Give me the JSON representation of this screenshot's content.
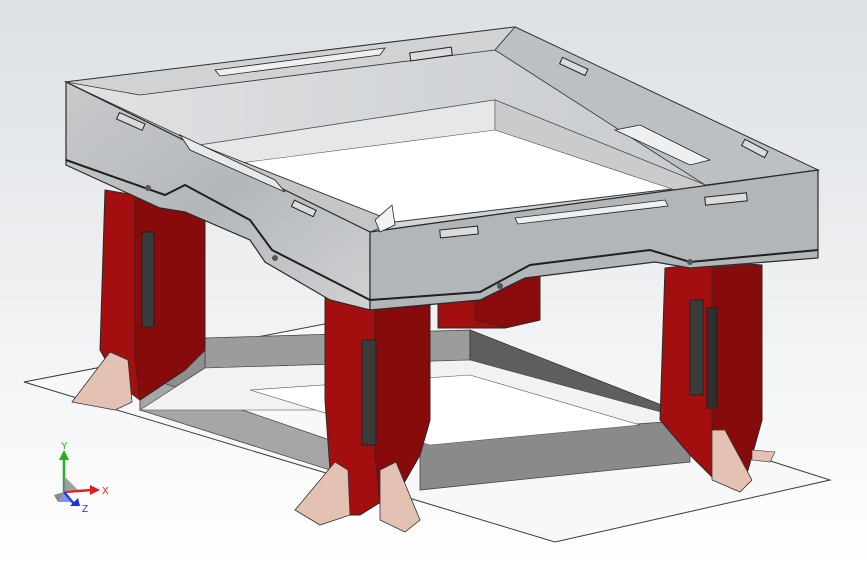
{
  "app": {
    "title": ""
  },
  "viewport": {
    "background_top": "#dde0e4",
    "background_bottom": "#ffffff"
  },
  "model": {
    "colors": {
      "frame_face": "#b9bcbf",
      "frame_face_light": "#d4d6d8",
      "frame_face_dark": "#9a9da1",
      "frame_edge": "#2b2b2b",
      "leg": "#a30f0f",
      "leg_dark": "#7e0a0a",
      "leg_highlight": "#c81a1a",
      "leg_slot": "#3a3a3a",
      "gusset": "#e7c6b8",
      "base_plate": "#f7f7f7",
      "base_beam": "#8c8c8c",
      "base_beam_dark": "#5d5d5d"
    }
  },
  "triad": {
    "x_label": "X",
    "y_label": "Y",
    "z_label": "Z",
    "x_color": "#e02020",
    "y_color": "#20b020",
    "z_color": "#2030e0"
  }
}
